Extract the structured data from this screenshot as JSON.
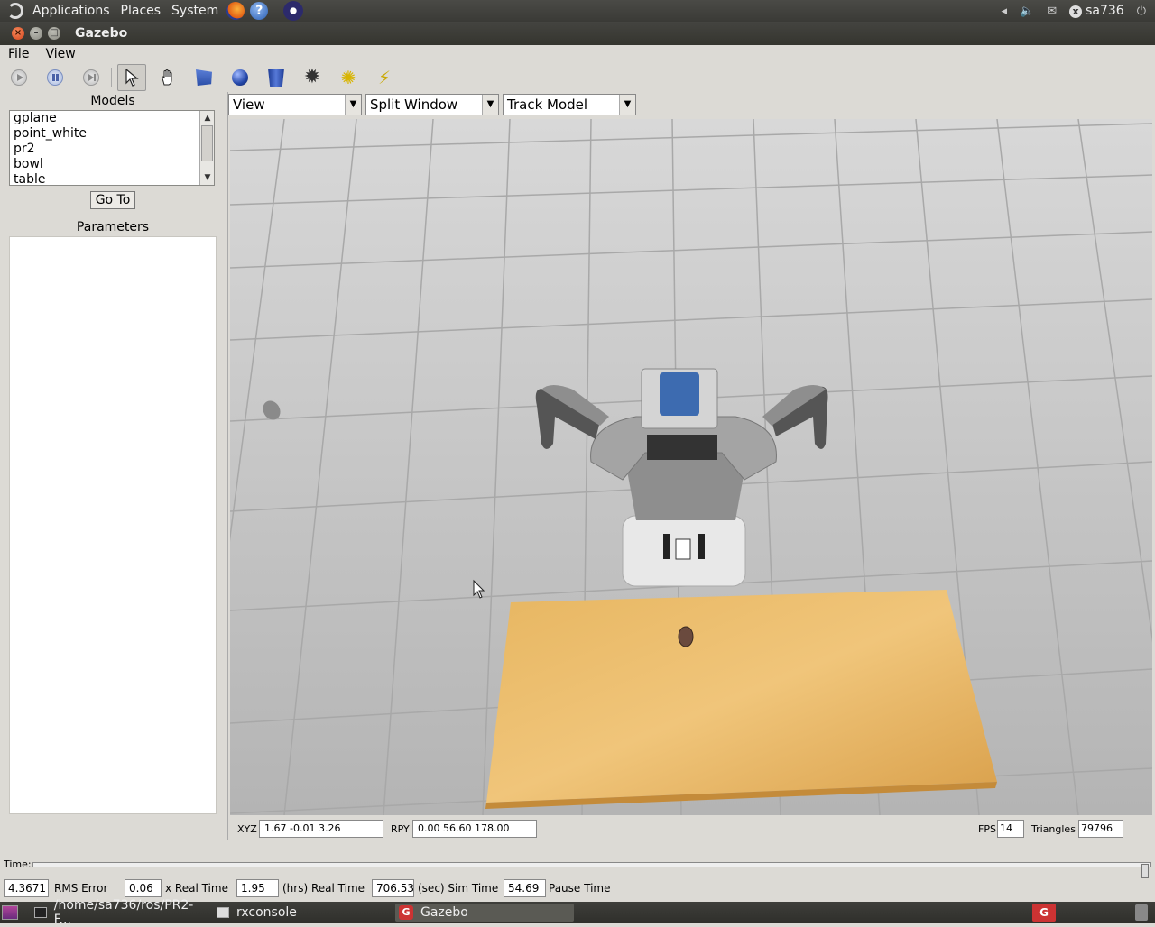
{
  "top_panel": {
    "menus": [
      "Applications",
      "Places",
      "System"
    ],
    "user": "sa736"
  },
  "window": {
    "title": "Gazebo"
  },
  "menubar": [
    "File",
    "View"
  ],
  "toolbar": {
    "tools": [
      "play-icon",
      "pause-icon",
      "step-icon",
      "select-arrow-icon",
      "hand-icon",
      "box-icon",
      "sphere-icon",
      "cylinder-icon",
      "point-light-icon",
      "spot-light-icon",
      "directional-light-icon"
    ]
  },
  "models": {
    "label": "Models",
    "items": [
      "gplane",
      "point_white",
      "pr2",
      "bowl",
      "table"
    ],
    "goto_label": "Go To"
  },
  "parameters": {
    "label": "Parameters"
  },
  "view_controls": {
    "view": "View",
    "split": "Split Window",
    "track": "Track Model"
  },
  "camera": {
    "xyz_label": "XYZ",
    "xyz": "1.67  -0.01   3.26",
    "rpy_label": "RPY",
    "rpy": "0.00  56.60 178.00",
    "fps_label": "FPS",
    "fps": "14",
    "triangles_label": "Triangles",
    "triangles": "79796"
  },
  "time": {
    "label": "Time:"
  },
  "stats": {
    "rms_error": "4.3671",
    "rms_label": "RMS Error",
    "real_time_factor": "0.06",
    "real_time_factor_label": "x Real Time",
    "real_time_hrs": "1.95",
    "real_time_hrs_label": "(hrs) Real Time",
    "sim_time": "706.53",
    "sim_time_label": "(sec) Sim Time",
    "pause_time": "54.69",
    "pause_time_label": "Pause Time"
  },
  "taskbar": {
    "tasks": [
      "/home/sa736/ros/PR2-F...",
      "rxconsole",
      "Gazebo"
    ]
  }
}
